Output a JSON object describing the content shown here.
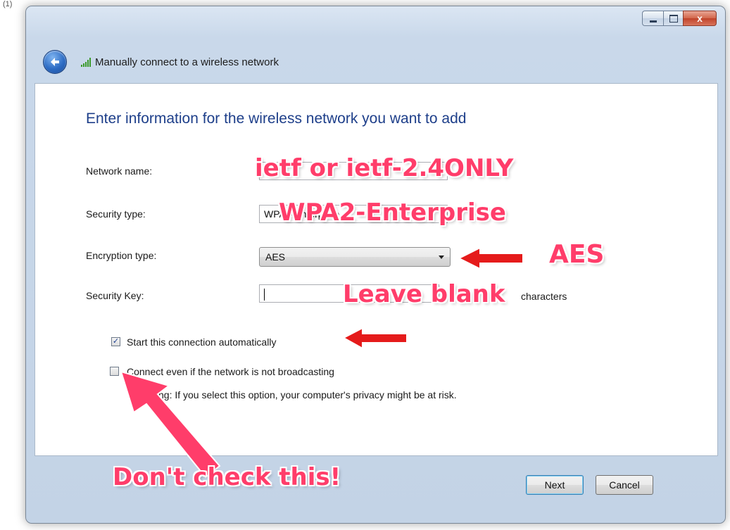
{
  "window": {
    "title": "Manually connect to a wireless network",
    "controls": {
      "minimize": "minimize",
      "maximize": "maximize",
      "close": "x"
    }
  },
  "heading": "Enter information for the wireless network you want to add",
  "fields": {
    "network_name": {
      "label": "Network name:",
      "value": ""
    },
    "security_type": {
      "label": "Security type:",
      "value": "WPA2-Enterprise"
    },
    "encryption_type": {
      "label": "Encryption type:",
      "value": "AES"
    },
    "security_key": {
      "label": "Security Key:",
      "value": "",
      "hint": "characters"
    }
  },
  "checkboxes": {
    "start_auto": {
      "label": "Start this connection automatically",
      "checked": true,
      "mark": "✓"
    },
    "connect_hidden": {
      "label": "Connect even if the network is not broadcasting",
      "checked": false,
      "mark": ""
    }
  },
  "warning": "ng: If you select this option, your computer's privacy might be at risk.",
  "buttons": {
    "next": "Next",
    "cancel": "Cancel"
  },
  "annotations": {
    "network": "ietf or ietf-2.4ONLY",
    "security": "WPA2-Enterprise",
    "encryption": "AES",
    "key": "Leave blank",
    "checkbox": "Don't check this!"
  },
  "colors": {
    "annotation": "#ff3d6a",
    "arrow": "#e51b1b",
    "heading": "#1e3f8a"
  },
  "corner_mark": "(1)"
}
